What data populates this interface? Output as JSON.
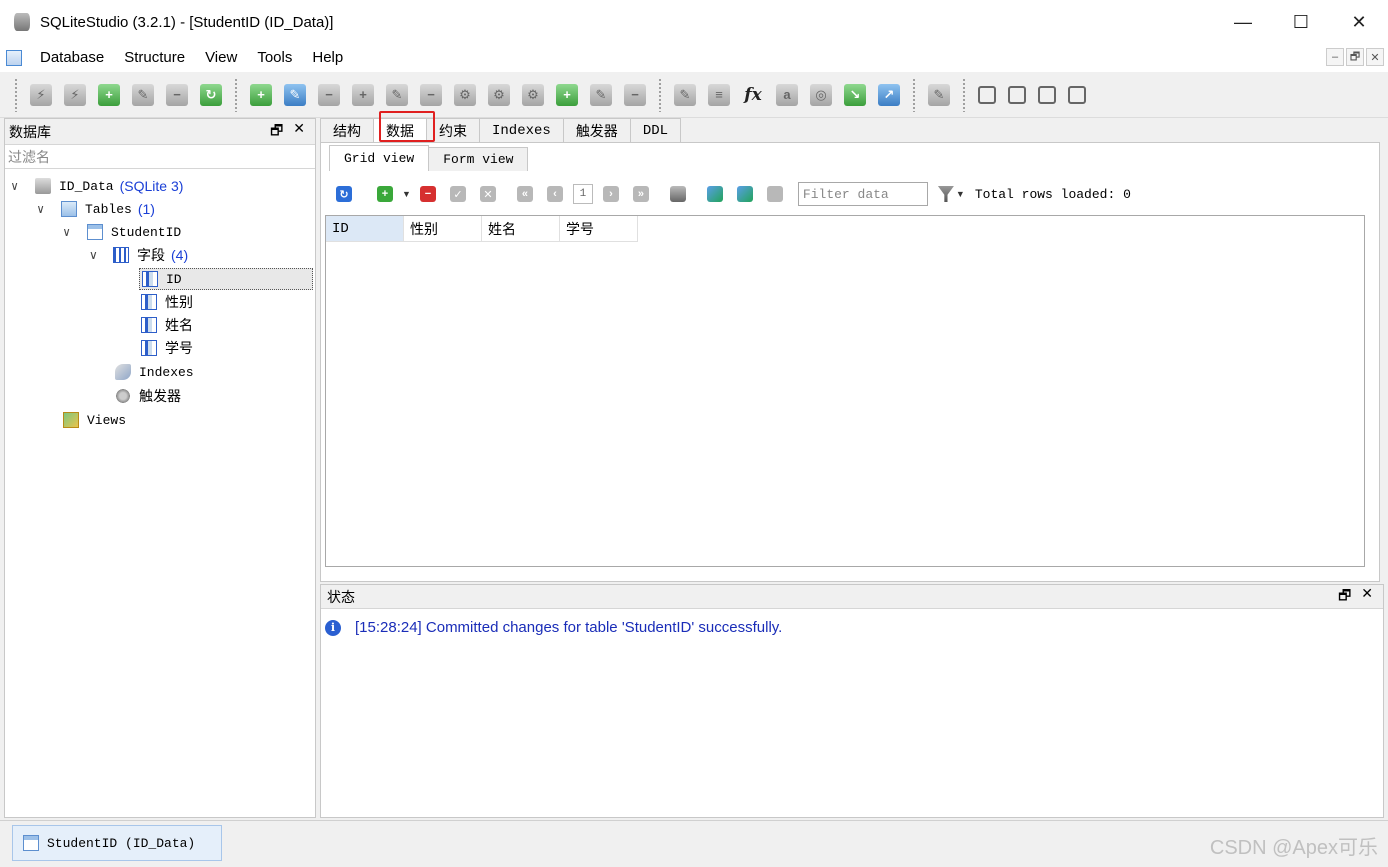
{
  "window": {
    "title": "SQLiteStudio (3.2.1) - [StudentID (ID_Data)]",
    "controls": {
      "minimize": "—",
      "maximize": "☐",
      "close": "✕"
    }
  },
  "menu": {
    "items": [
      "Database",
      "Structure",
      "View",
      "Tools",
      "Help"
    ],
    "mdi_controls": {
      "minimize": "–",
      "restore": "🗗",
      "close": "✕"
    }
  },
  "database_panel": {
    "title": "数据库",
    "filter_placeholder": "过滤名",
    "tree": {
      "db_name": "ID_Data",
      "db_type": "(SQLite 3)",
      "tables_label": "Tables",
      "tables_count": "(1)",
      "table_name": "StudentID",
      "columns_label": "字段",
      "columns_count": "(4)",
      "columns": [
        "ID",
        "性别",
        "姓名",
        "学号"
      ],
      "indexes_label": "Indexes",
      "triggers_label": "触发器",
      "views_label": "Views"
    }
  },
  "tabs": [
    "结构",
    "数据",
    "约束",
    "Indexes",
    "触发器",
    "DDL"
  ],
  "active_tab": "数据",
  "subtabs": [
    "Grid view",
    "Form view"
  ],
  "grid_toolbar": {
    "page": "1",
    "filter_placeholder": "Filter data",
    "rows_loaded": "Total rows loaded: 0"
  },
  "grid": {
    "columns": [
      "ID",
      "性别",
      "姓名",
      "学号"
    ]
  },
  "status_panel": {
    "title": "状态",
    "message": "[15:28:24]  Committed changes for table 'StudentID' successfully."
  },
  "taskbar": {
    "window_button": "StudentID (ID_Data)"
  },
  "watermark": "CSDN @Apex可乐"
}
